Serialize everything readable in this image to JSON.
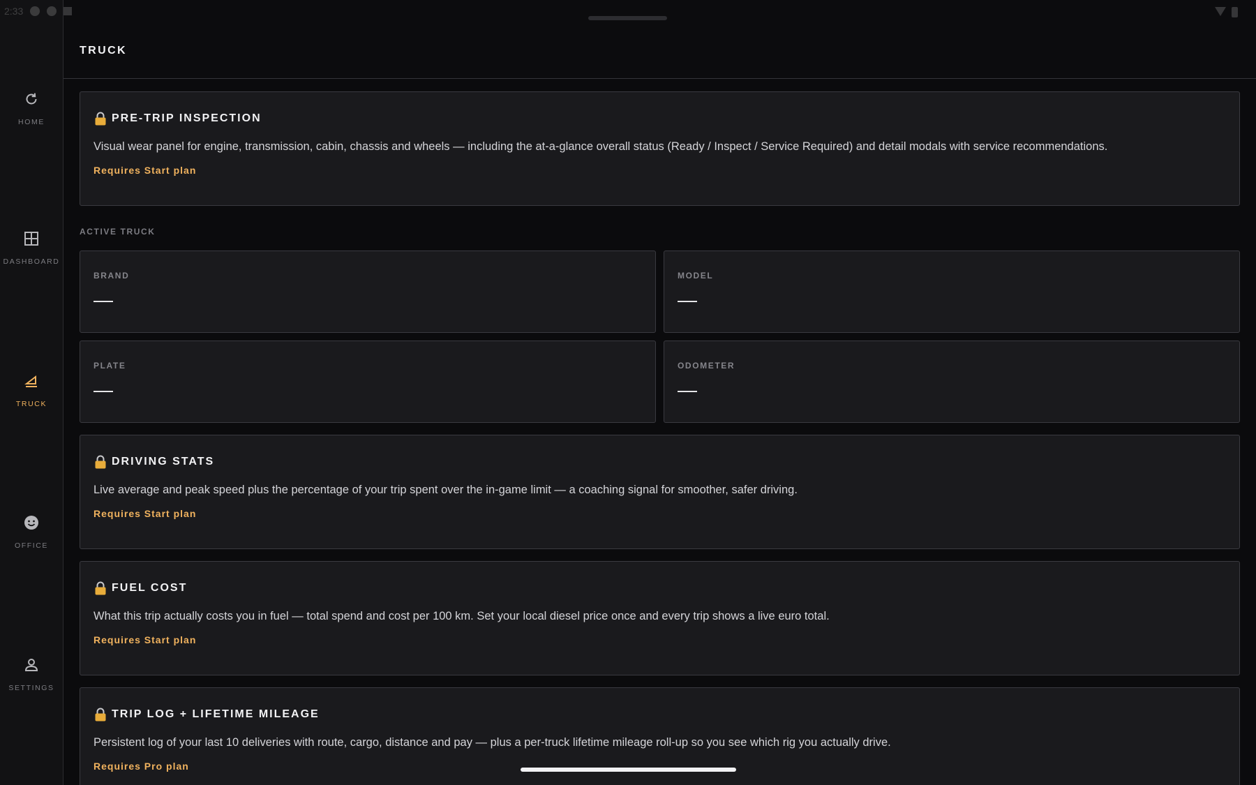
{
  "status_bar": {
    "time": "2:33"
  },
  "sidebar": {
    "items": [
      {
        "label": "HOME",
        "icon": "refresh-icon",
        "active": false
      },
      {
        "label": "DASHBOARD",
        "icon": "grid-icon",
        "active": false
      },
      {
        "label": "TRUCK",
        "icon": "truck-icon",
        "active": true
      },
      {
        "label": "OFFICE",
        "icon": "smiley-icon",
        "active": false
      },
      {
        "label": "SETTINGS",
        "icon": "person-icon",
        "active": false
      }
    ]
  },
  "header": {
    "title": "TRUCK"
  },
  "features": {
    "pretrip": {
      "title": "PRE-TRIP INSPECTION",
      "description": "Visual wear panel for engine, transmission, cabin, chassis and wheels — including the at-a-glance overall status (Ready / Inspect / Service Required) and detail modals with service recommendations.",
      "requirement": "Requires Start plan"
    },
    "driving_stats": {
      "title": "DRIVING STATS",
      "description": "Live average and peak speed plus the percentage of your trip spent over the in-game limit — a coaching signal for smoother, safer driving.",
      "requirement": "Requires Start plan"
    },
    "fuel_cost": {
      "title": "FUEL COST",
      "description": "What this trip actually costs you in fuel — total spend and cost per 100 km. Set your local diesel price once and every trip shows a live euro total.",
      "requirement": "Requires Start plan"
    },
    "trip_log": {
      "title": "TRIP LOG + LIFETIME MILEAGE",
      "description": "Persistent log of your last 10 deliveries with route, cargo, distance and pay — plus a per-truck lifetime mileage roll-up so you see which rig you actually drive.",
      "requirement": "Requires Pro plan"
    }
  },
  "active_truck": {
    "section_label": "ACTIVE TRUCK",
    "brand": {
      "label": "BRAND",
      "value": "—"
    },
    "model": {
      "label": "MODEL",
      "value": "—"
    },
    "plate": {
      "label": "PLATE",
      "value": "—"
    },
    "odometer": {
      "label": "ODOMETER",
      "value": "—"
    }
  },
  "colors": {
    "accent": "#f0b25e",
    "background": "#0b0b0d",
    "card": "#1a1a1d",
    "border": "#3a3a40"
  }
}
